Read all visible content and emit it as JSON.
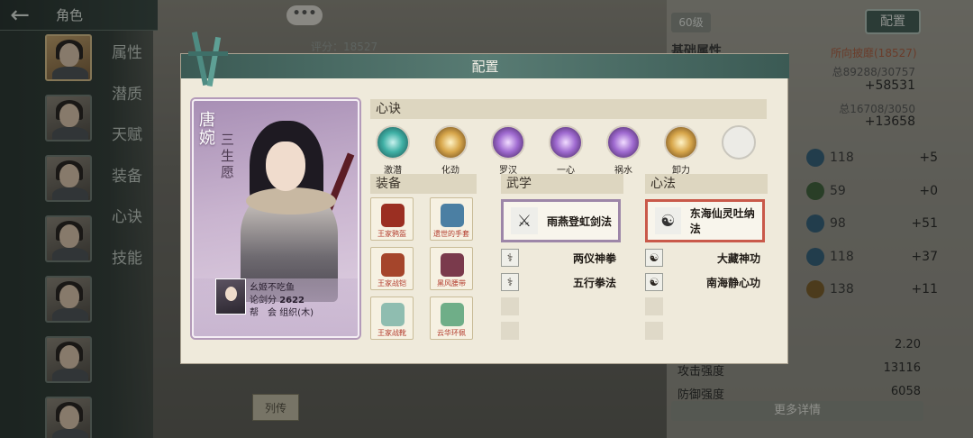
{
  "top_bar": {
    "title": "角色",
    "back_icon": "back-arrow-icon"
  },
  "nav_menu": [
    "属性",
    "潜质",
    "天赋",
    "装备",
    "心诀",
    "技能"
  ],
  "background": {
    "score_label": "评分：18527",
    "level_badge": "60级",
    "config_button": "配置",
    "basic_attr_heading": "基础属性",
    "faction_text": "所向披靡(18527)",
    "totals": [
      {
        "label": "总89288/30757",
        "big": "+58531"
      },
      {
        "label": "总16708/3050",
        "big": "+13658"
      }
    ],
    "stat_rows": [
      {
        "value": "118",
        "bonus": "+5"
      },
      {
        "value": "59",
        "bonus": "+0"
      },
      {
        "value": "98",
        "bonus": "+51"
      },
      {
        "value": "118",
        "bonus": "+37"
      },
      {
        "value": "138",
        "bonus": "+11"
      }
    ],
    "bottom_stats": [
      {
        "label": "",
        "value": "2.20"
      },
      {
        "label": "攻击强度",
        "value": "13116"
      },
      {
        "label": "防御强度",
        "value": "6058"
      }
    ],
    "more_details": "更多详情",
    "lie_button": "列传"
  },
  "modal": {
    "title": "配置",
    "card": {
      "name": "唐婉",
      "subtitle": "三生愿",
      "player_name": "幺姬不吃鱼",
      "sword_score_label": "论剑分",
      "sword_score": "2622",
      "guild_label": "帮　会",
      "guild_name": "组织(木)"
    },
    "xinjue": {
      "title": "心诀",
      "items": [
        {
          "label": "激潜",
          "style": "teal"
        },
        {
          "label": "化劲",
          "style": "gold"
        },
        {
          "label": "罗汉",
          "style": "purp"
        },
        {
          "label": "一心",
          "style": "purp"
        },
        {
          "label": "祸水",
          "style": "purp"
        },
        {
          "label": "卸力",
          "style": "gold"
        },
        {
          "label": "",
          "style": "empty"
        }
      ]
    },
    "equipment": {
      "title": "装备",
      "items": [
        {
          "label": "王家鸦盔",
          "color": "#9b2f22"
        },
        {
          "label": "遗世的手套",
          "color": "#4b7fa3"
        },
        {
          "label": "王家战铠",
          "color": "#a5452b"
        },
        {
          "label": "黑风腰带",
          "color": "#7a3a4c"
        },
        {
          "label": "王家战靴",
          "color": "#8fbdb0"
        },
        {
          "label": "云华环佩",
          "color": "#6fae88"
        }
      ]
    },
    "wuxue": {
      "title": "武学",
      "main": "雨燕登虹剑法",
      "subs": [
        "两仪神拳",
        "五行拳法"
      ]
    },
    "xinfa": {
      "title": "心法",
      "main": "东海仙灵吐纳法",
      "subs": [
        "大藏神功",
        "南海静心功"
      ]
    }
  }
}
